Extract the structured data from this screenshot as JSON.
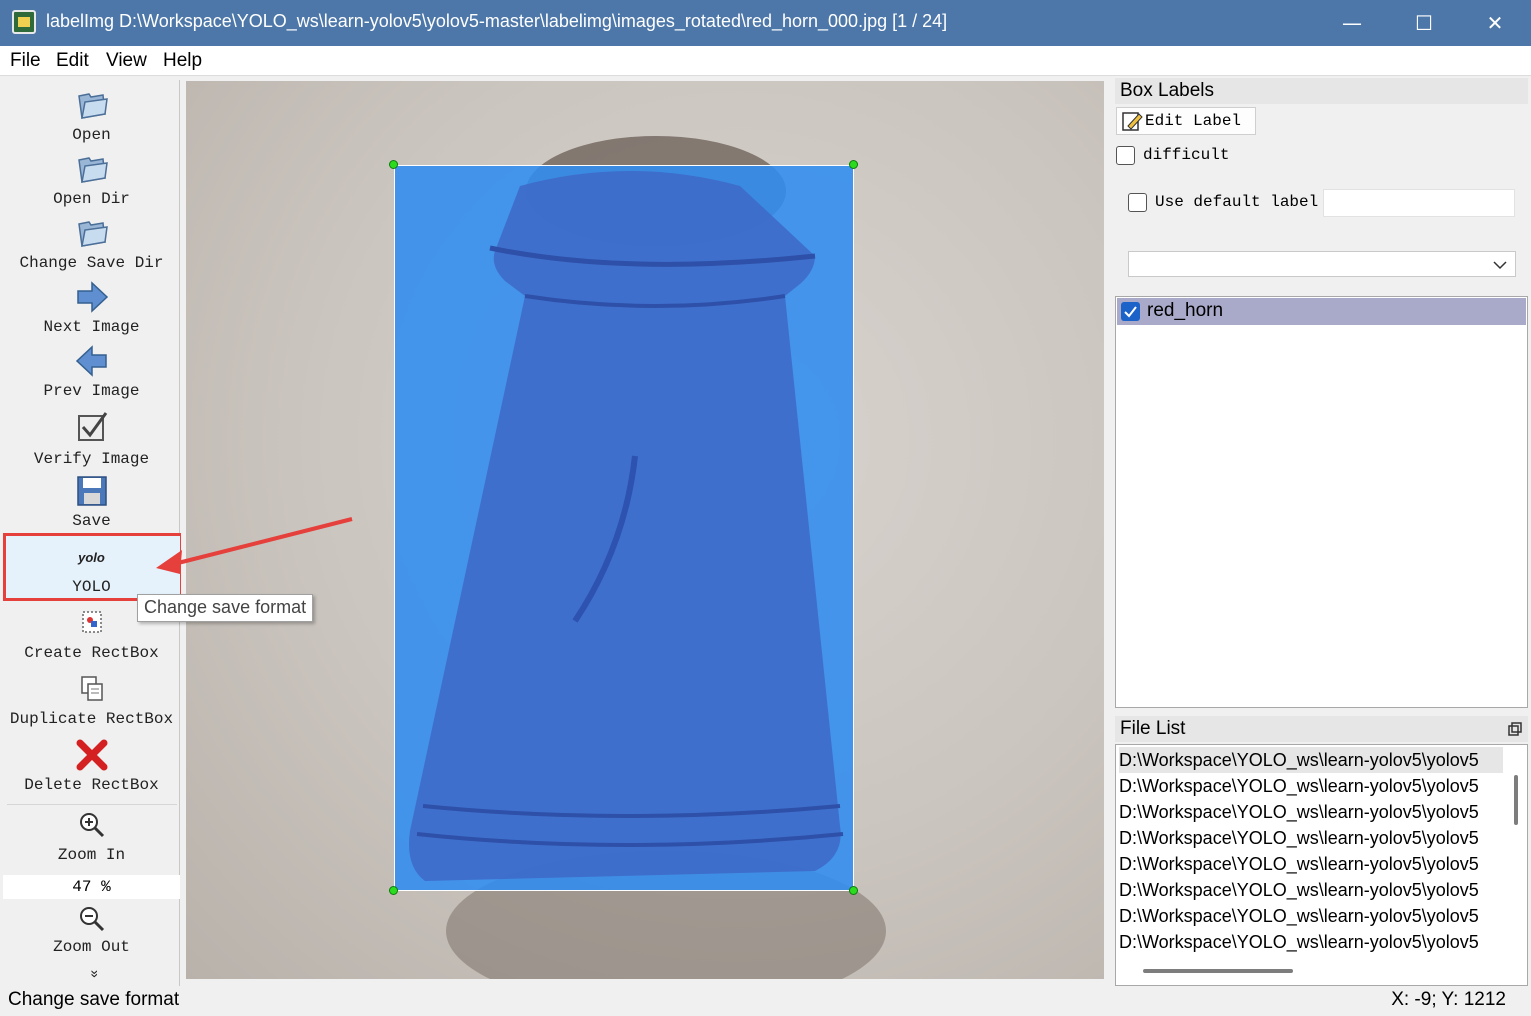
{
  "window": {
    "title": "labelImg D:\\Workspace\\YOLO_ws\\learn-yolov5\\yolov5-master\\labelimg\\images_rotated\\red_horn_000.jpg [1 / 24]",
    "minimize_glyph": "—",
    "maximize_glyph": "☐",
    "close_glyph": "✕"
  },
  "menu": {
    "file": "File",
    "edit": "Edit",
    "view": "View",
    "help": "Help"
  },
  "toolbar": {
    "open": "Open",
    "open_dir": "Open Dir",
    "change_save_dir": "Change Save Dir",
    "next_image": "Next Image",
    "prev_image": "Prev Image",
    "verify_image": "Verify Image",
    "save": "Save",
    "yolo_logo": "yolo",
    "yolo": "YOLO",
    "create_rectbox": "Create RectBox",
    "duplicate_rectbox": "Duplicate RectBox",
    "delete_rectbox": "Delete RectBox",
    "zoom_in": "Zoom In",
    "zoom_value": "47 %",
    "zoom_out": "Zoom Out",
    "more": "»"
  },
  "tooltip": "Change save format",
  "box_labels": {
    "title": "Box Labels",
    "edit_label": "Edit Label",
    "difficult": "difficult",
    "use_default_label": "Use default label",
    "default_label_value": "",
    "combo_value": "",
    "labels": [
      {
        "name": "red_horn",
        "checked": true
      }
    ]
  },
  "file_list": {
    "title": "File List",
    "files": [
      "D:\\Workspace\\YOLO_ws\\learn-yolov5\\yolov5",
      "D:\\Workspace\\YOLO_ws\\learn-yolov5\\yolov5",
      "D:\\Workspace\\YOLO_ws\\learn-yolov5\\yolov5",
      "D:\\Workspace\\YOLO_ws\\learn-yolov5\\yolov5",
      "D:\\Workspace\\YOLO_ws\\learn-yolov5\\yolov5",
      "D:\\Workspace\\YOLO_ws\\learn-yolov5\\yolov5",
      "D:\\Workspace\\YOLO_ws\\learn-yolov5\\yolov5",
      "D:\\Workspace\\YOLO_ws\\learn-yolov5\\yolov5"
    ]
  },
  "status": {
    "message": "Change save format",
    "coords": "X: -9; Y: 1212"
  },
  "colors": {
    "titlebar": "#4d77a8",
    "bbox_fill": "#308cf0",
    "handle": "#2bdc1e",
    "highlight": "#e5403c",
    "selected_label": "#a9a9c9"
  }
}
